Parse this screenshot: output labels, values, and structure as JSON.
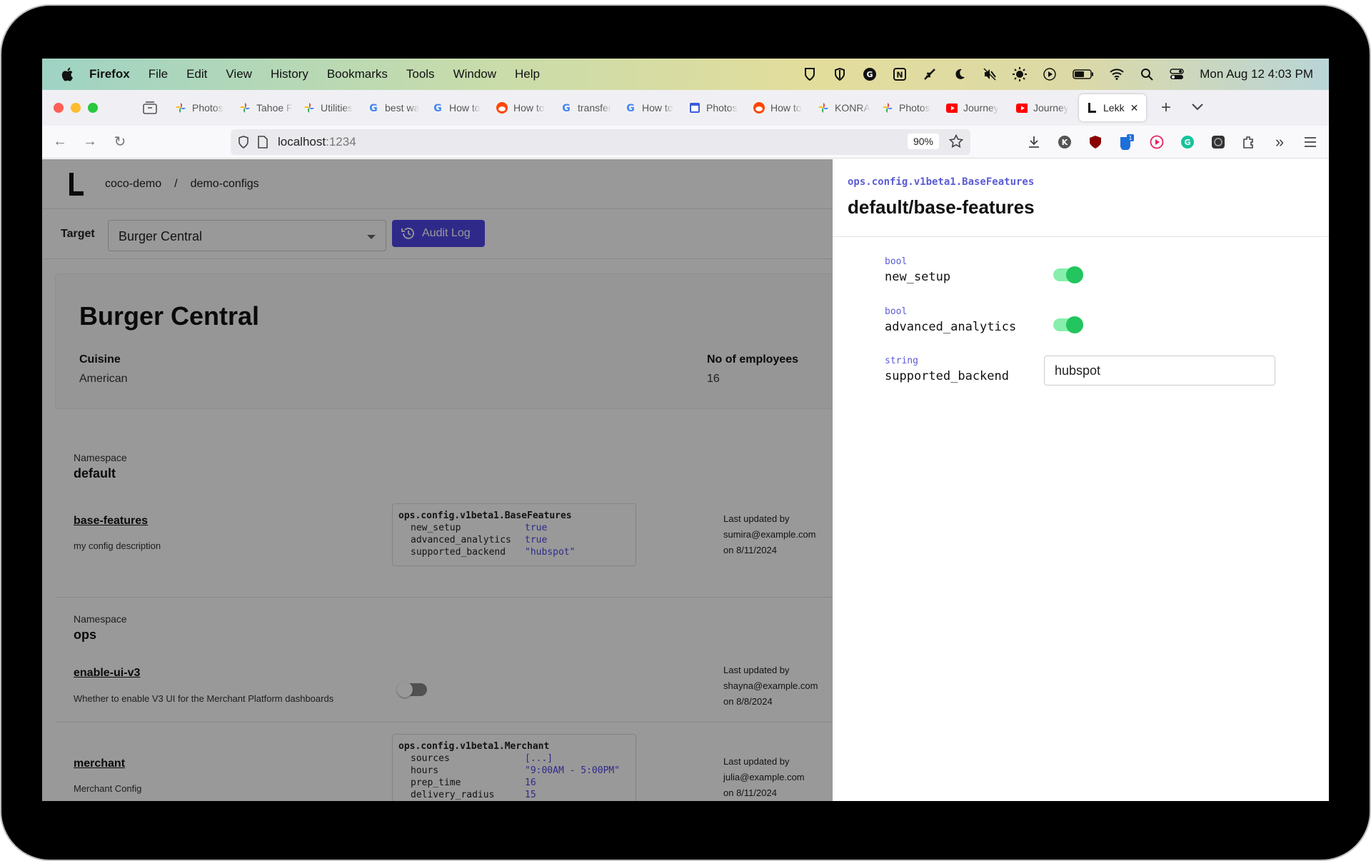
{
  "menubar": {
    "app_name": "Firefox",
    "items": [
      "File",
      "Edit",
      "View",
      "History",
      "Bookmarks",
      "Tools",
      "Window",
      "Help"
    ],
    "clock": "Mon Aug 12  4:03 PM"
  },
  "tabs": [
    {
      "label": "Photos",
      "icon": "google-photos-icon",
      "color": "#ea4335"
    },
    {
      "label": "Tahoe F",
      "icon": "google-photos-icon",
      "color": "#fbbc05"
    },
    {
      "label": "Utilities",
      "icon": "google-photos-icon",
      "color": "#34a853"
    },
    {
      "label": "best wa",
      "icon": "google-icon",
      "color": "#4285f4"
    },
    {
      "label": "How to",
      "icon": "google-icon",
      "color": "#4285f4"
    },
    {
      "label": "How to",
      "icon": "reddit-icon",
      "color": "#ff4500"
    },
    {
      "label": "transfer",
      "icon": "google-icon",
      "color": "#4285f4"
    },
    {
      "label": "How to",
      "icon": "google-icon",
      "color": "#4285f4"
    },
    {
      "label": "Photos",
      "icon": "calendar-icon",
      "color": "#3b5bdb"
    },
    {
      "label": "How to",
      "icon": "reddit-icon",
      "color": "#ff4500"
    },
    {
      "label": "KONRA",
      "icon": "google-photos-icon",
      "color": "#ea4335"
    },
    {
      "label": "Photos",
      "icon": "google-photos-icon",
      "color": "#fbbc05"
    },
    {
      "label": "Journey",
      "icon": "youtube-icon",
      "color": "#ff0000"
    },
    {
      "label": "Journey",
      "icon": "youtube-icon",
      "color": "#ff0000"
    },
    {
      "label": "Lekk",
      "icon": "lekko-icon",
      "color": "#111111",
      "active": true
    }
  ],
  "nav": {
    "url_host": "localhost",
    "url_port": ":1234",
    "zoom": "90%"
  },
  "app": {
    "breadcrumb": [
      "coco-demo",
      "/",
      "demo-configs"
    ],
    "target_label": "Target",
    "target_value": "Burger Central",
    "audit_label": "Audit Log",
    "accent": "#4f46e5",
    "card": {
      "title": "Burger Central",
      "fields": [
        {
          "label": "Cuisine",
          "value": "American"
        },
        {
          "label": "No of employees",
          "value": "16"
        }
      ]
    },
    "namespace_label": "Namespace",
    "updated_label": "Last updated by",
    "sections": [
      {
        "namespace": "default",
        "configs": [
          {
            "name": "base-features",
            "description": "my config description",
            "type": "ops.config.v1beta1.BaseFeatures",
            "fields": [
              {
                "k": "new_setup",
                "v": "true"
              },
              {
                "k": "advanced_analytics",
                "v": "true"
              },
              {
                "k": "supported_backend",
                "v": "\"hubspot\""
              }
            ],
            "updated_by": "sumira@example.com",
            "updated_on": "on 8/11/2024"
          }
        ]
      },
      {
        "namespace": "ops",
        "configs": [
          {
            "name": "enable-ui-v3",
            "description": "Whether to enable V3 UI for the Merchant Platform dashboards",
            "toggle": false,
            "updated_by": "shayna@example.com",
            "updated_on": "on 8/8/2024"
          },
          {
            "name": "merchant",
            "description": "Merchant Config",
            "type": "ops.config.v1beta1.Merchant",
            "fields": [
              {
                "k": "sources",
                "v": "[...]"
              },
              {
                "k": "hours",
                "v": "\"9:00AM - 5:00PM\""
              },
              {
                "k": "prep_time",
                "v": "16"
              },
              {
                "k": "delivery_radius",
                "v": "15"
              }
            ],
            "updated_by": "julia@example.com",
            "updated_on": "on 8/11/2024"
          }
        ]
      }
    ]
  },
  "drawer": {
    "type": "ops.config.v1beta1.BaseFeatures",
    "title": "default/base-features",
    "fields": [
      {
        "type": "bool",
        "name": "new_setup",
        "value": true
      },
      {
        "type": "bool",
        "name": "advanced_analytics",
        "value": true
      },
      {
        "type": "string",
        "name": "supported_backend",
        "value": "hubspot"
      }
    ]
  }
}
